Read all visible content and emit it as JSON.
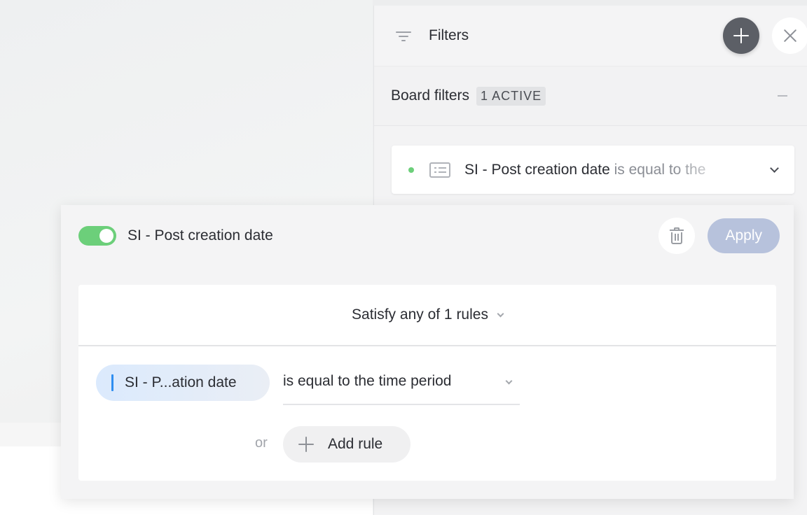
{
  "panel": {
    "title": "Filters",
    "board_filters_label": "Board filters",
    "active_badge": "1 ACTIVE",
    "filter_card": {
      "field": "SI - Post creation date",
      "operator_preview": " is equal to the"
    }
  },
  "editor": {
    "title": "SI - Post creation date",
    "toggle_on": true,
    "apply_label": "Apply",
    "satisfy_label": "Satisfy any of 1 rules",
    "rule": {
      "field": "SI - P...ation date",
      "operator": "is equal to the time period"
    },
    "or_label": "or",
    "add_rule_label": "Add rule"
  },
  "colors": {
    "toggle": "#6ccf7a",
    "apply": "#b7c2dc",
    "field_accent": "#2f8ef0",
    "active_dot": "#6ccf7a"
  },
  "icons": {
    "header": "filter-icon",
    "add": "plus-icon",
    "close": "close-icon",
    "collapse": "minus-icon",
    "filter_type": "list-icon",
    "expand": "chevron-down-icon",
    "delete": "trash-icon"
  }
}
